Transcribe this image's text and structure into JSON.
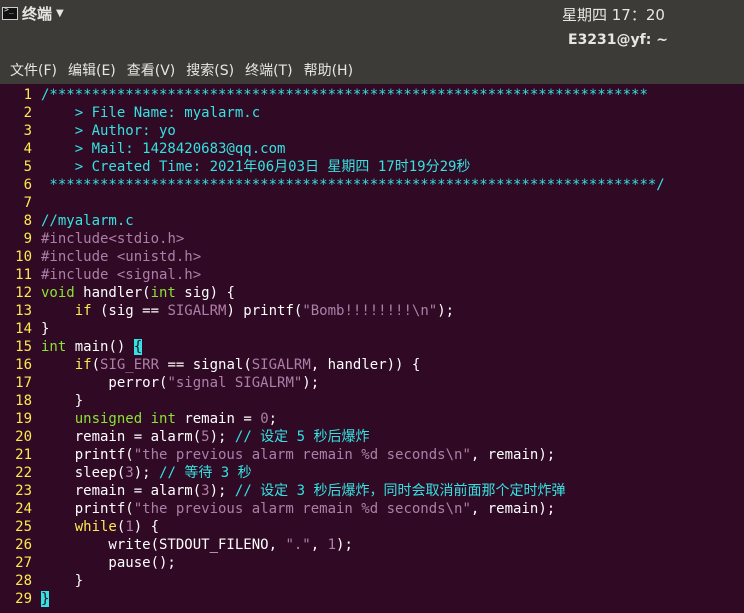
{
  "topbar": {
    "app_name": "终端",
    "clock": "星期四 17：20"
  },
  "window": {
    "title": "E3231@yf: ~"
  },
  "menu": [
    "文件(F)",
    "编辑(E)",
    "查看(V)",
    "搜索(S)",
    "终端(T)",
    "帮助(H)"
  ],
  "code_lines": [
    {
      "n": "1",
      "s": [
        [
          "cm",
          "/***********************************************************************"
        ]
      ]
    },
    {
      "n": "2",
      "s": [
        [
          "cm",
          "    > File Name: myalarm.c"
        ]
      ]
    },
    {
      "n": "3",
      "s": [
        [
          "cm",
          "    > Author: yo"
        ]
      ]
    },
    {
      "n": "4",
      "s": [
        [
          "cm",
          "    > Mail: 1428420683@qq.com"
        ]
      ]
    },
    {
      "n": "5",
      "s": [
        [
          "cm",
          "    > Created Time: 2021年06月03日 星期四 17时19分29秒"
        ]
      ]
    },
    {
      "n": "6",
      "s": [
        [
          "cm",
          " ************************************************************************/"
        ]
      ]
    },
    {
      "n": "7",
      "s": []
    },
    {
      "n": "8",
      "s": [
        [
          "cm",
          "//myalarm.c"
        ]
      ]
    },
    {
      "n": "9",
      "s": [
        [
          "pp",
          "#include"
        ],
        [
          "st",
          "<stdio.h>"
        ]
      ]
    },
    {
      "n": "10",
      "s": [
        [
          "pp",
          "#include "
        ],
        [
          "st",
          "<unistd.h>"
        ]
      ]
    },
    {
      "n": "11",
      "s": [
        [
          "pp",
          "#include "
        ],
        [
          "st",
          "<signal.h>"
        ]
      ]
    },
    {
      "n": "12",
      "s": [
        [
          "ty",
          "void"
        ],
        [
          "tx",
          " handler("
        ],
        [
          "ty",
          "int"
        ],
        [
          "tx",
          " sig) {"
        ]
      ]
    },
    {
      "n": "13",
      "s": [
        [
          "tx",
          "    "
        ],
        [
          "kw",
          "if"
        ],
        [
          "tx",
          " (sig == "
        ],
        [
          "nm",
          "SIGALRM"
        ],
        [
          "tx",
          ") printf("
        ],
        [
          "st",
          "\"Bomb!!!!!!!!"
        ],
        [
          "nm",
          "\\n"
        ],
        [
          "st",
          "\""
        ],
        [
          "tx",
          ");"
        ]
      ]
    },
    {
      "n": "14",
      "s": [
        [
          "tx",
          "}"
        ]
      ]
    },
    {
      "n": "15",
      "s": [
        [
          "ty",
          "int"
        ],
        [
          "tx",
          " main() "
        ],
        [
          "cur",
          "{"
        ]
      ]
    },
    {
      "n": "16",
      "s": [
        [
          "tx",
          "    "
        ],
        [
          "kw",
          "if"
        ],
        [
          "tx",
          "("
        ],
        [
          "nm",
          "SIG_ERR"
        ],
        [
          "tx",
          " == signal("
        ],
        [
          "nm",
          "SIGALRM"
        ],
        [
          "tx",
          ", handler)) {"
        ]
      ]
    },
    {
      "n": "17",
      "s": [
        [
          "tx",
          "        perror("
        ],
        [
          "st",
          "\"signal SIGALRM\""
        ],
        [
          "tx",
          ");"
        ]
      ]
    },
    {
      "n": "18",
      "s": [
        [
          "tx",
          "    }"
        ]
      ]
    },
    {
      "n": "19",
      "s": [
        [
          "tx",
          "    "
        ],
        [
          "ty",
          "unsigned"
        ],
        [
          "tx",
          " "
        ],
        [
          "ty",
          "int"
        ],
        [
          "tx",
          " remain = "
        ],
        [
          "nm",
          "0"
        ],
        [
          "tx",
          ";"
        ]
      ]
    },
    {
      "n": "20",
      "s": [
        [
          "tx",
          "    remain = alarm("
        ],
        [
          "nm",
          "5"
        ],
        [
          "tx",
          "); "
        ],
        [
          "cm",
          "// 设定 5 秒后爆炸"
        ]
      ]
    },
    {
      "n": "21",
      "s": [
        [
          "tx",
          "    printf("
        ],
        [
          "st",
          "\"the previous alarm remain %d seconds"
        ],
        [
          "nm",
          "\\n"
        ],
        [
          "st",
          "\""
        ],
        [
          "tx",
          ", remain);"
        ]
      ]
    },
    {
      "n": "22",
      "s": [
        [
          "tx",
          "    sleep("
        ],
        [
          "nm",
          "3"
        ],
        [
          "tx",
          "); "
        ],
        [
          "cm",
          "// 等待 3 秒"
        ]
      ]
    },
    {
      "n": "23",
      "s": [
        [
          "tx",
          "    remain = alarm("
        ],
        [
          "nm",
          "3"
        ],
        [
          "tx",
          "); "
        ],
        [
          "cm",
          "// 设定 3 秒后爆炸，同时会取消前面那个定时炸弹"
        ]
      ]
    },
    {
      "n": "24",
      "s": [
        [
          "tx",
          "    printf("
        ],
        [
          "st",
          "\"the previous alarm remain %d seconds"
        ],
        [
          "nm",
          "\\n"
        ],
        [
          "st",
          "\""
        ],
        [
          "tx",
          ", remain);"
        ]
      ]
    },
    {
      "n": "25",
      "s": [
        [
          "tx",
          "    "
        ],
        [
          "kw",
          "while"
        ],
        [
          "tx",
          "("
        ],
        [
          "nm",
          "1"
        ],
        [
          "tx",
          ") {"
        ]
      ]
    },
    {
      "n": "26",
      "s": [
        [
          "tx",
          "        write(STDOUT_FILENO, "
        ],
        [
          "st",
          "\".\""
        ],
        [
          "tx",
          ", "
        ],
        [
          "nm",
          "1"
        ],
        [
          "tx",
          ");"
        ]
      ]
    },
    {
      "n": "27",
      "s": [
        [
          "tx",
          "        pause();"
        ]
      ]
    },
    {
      "n": "28",
      "s": [
        [
          "tx",
          "    }"
        ]
      ]
    },
    {
      "n": "29",
      "s": [
        [
          "cur",
          "}"
        ]
      ]
    }
  ]
}
